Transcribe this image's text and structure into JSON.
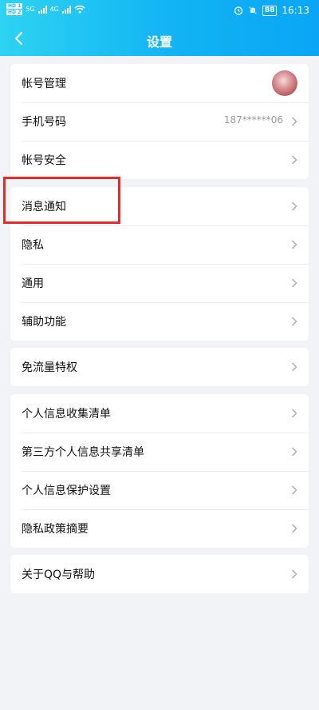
{
  "status_bar": {
    "left_badges": [
      "HD 1",
      "HD 2"
    ],
    "network_labels": [
      "5G",
      "4G"
    ],
    "battery": "88",
    "time": "16:13"
  },
  "nav": {
    "title": "设置",
    "back_icon": "chevron-left-icon"
  },
  "groups": [
    {
      "items": [
        {
          "label": "帐号管理",
          "trailing": "avatar"
        },
        {
          "label": "手机号码",
          "value": "187******06"
        },
        {
          "label": "帐号安全"
        }
      ]
    },
    {
      "items": [
        {
          "label": "消息通知"
        },
        {
          "label": "隐私"
        },
        {
          "label": "通用"
        },
        {
          "label": "辅助功能"
        }
      ]
    },
    {
      "items": [
        {
          "label": "免流量特权"
        }
      ]
    },
    {
      "items": [
        {
          "label": "个人信息收集清单"
        },
        {
          "label": "第三方个人信息共享清单"
        },
        {
          "label": "个人信息保护设置"
        },
        {
          "label": "隐私政策摘要"
        }
      ]
    },
    {
      "items": [
        {
          "label": "关于QQ与帮助"
        }
      ]
    }
  ],
  "colors": {
    "header_start": "#2ed3f2",
    "header_end": "#0aa6f5",
    "highlight_box": "#e52b2b",
    "background": "#f2f3f7"
  }
}
